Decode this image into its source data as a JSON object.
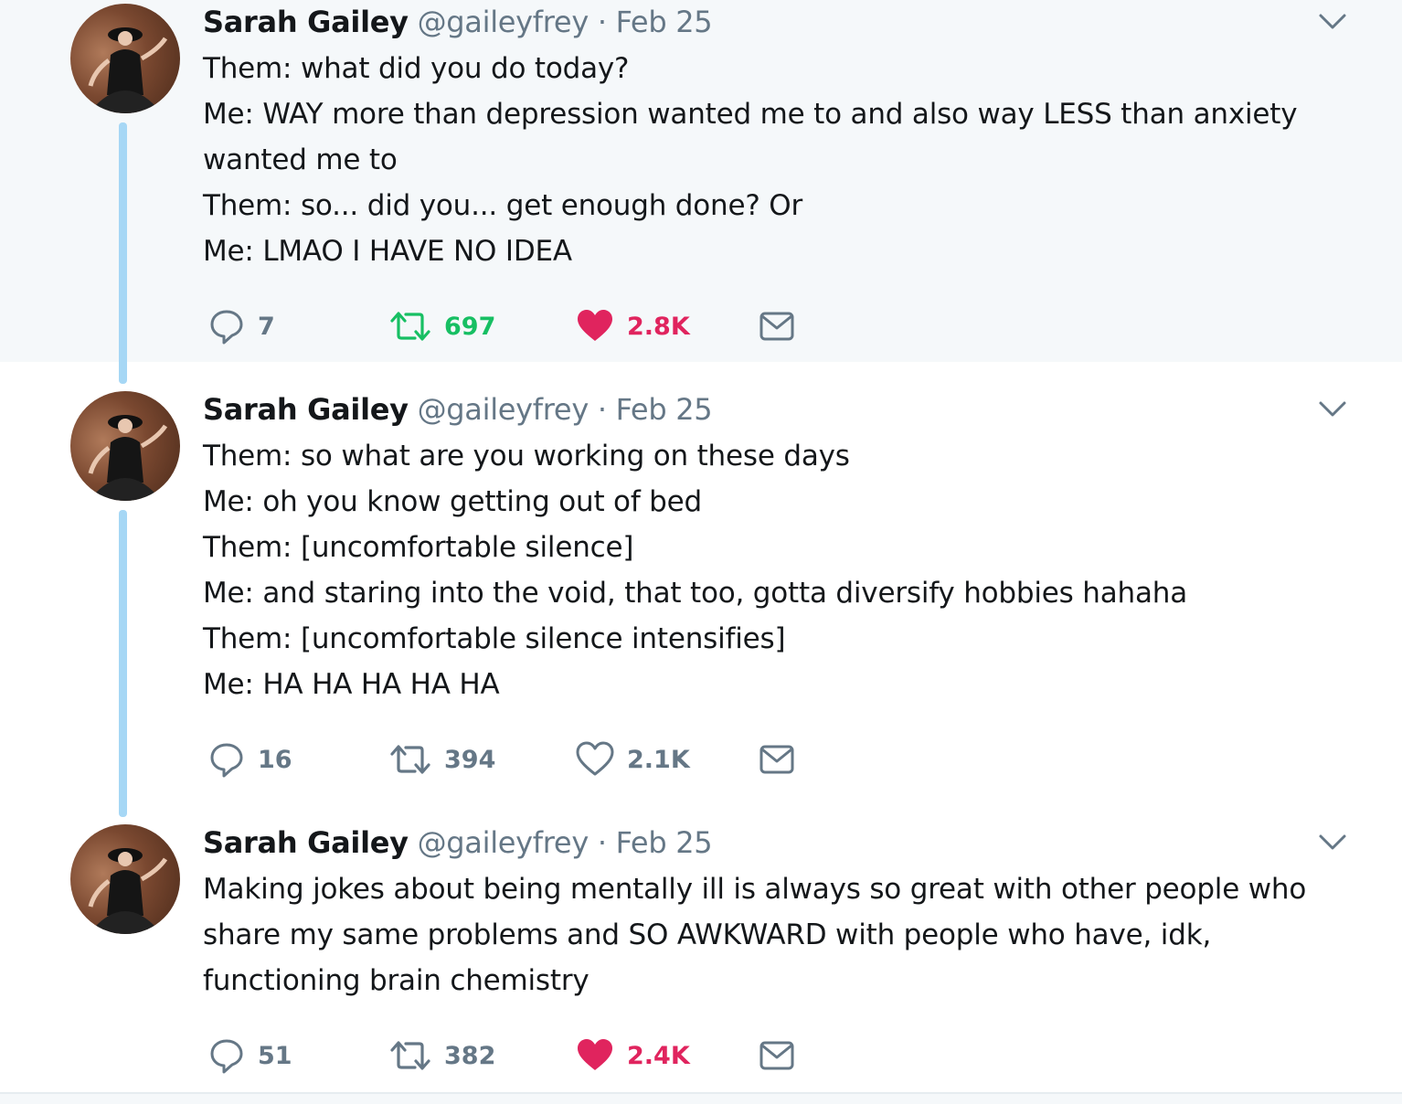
{
  "colors": {
    "thread_line": "#a6d7f5",
    "retweet_active": "#17bf63",
    "like_active": "#e0245e",
    "secondary_text": "#657786",
    "highlight_bg": "#f5f8fa"
  },
  "tweets": [
    {
      "name": "Sarah Gailey",
      "handle": "@gaileyfrey",
      "separator": "·",
      "date": "Feb 25",
      "lines": [
        "Them: what did you do today?",
        "Me: WAY more than depression wanted me to and also way LESS than anxiety",
        "wanted me to",
        "Them: so... did you... get enough done? Or",
        "Me: LMAO I HAVE NO IDEA"
      ],
      "replies": "7",
      "retweets": "697",
      "likes": "2.8K",
      "retweeted": true,
      "liked": true
    },
    {
      "name": "Sarah Gailey",
      "handle": "@gaileyfrey",
      "separator": "·",
      "date": "Feb 25",
      "lines": [
        "Them: so what are you working on these days",
        "Me: oh you know getting out of bed",
        "Them: [uncomfortable silence]",
        "Me: and staring into the void, that too, gotta diversify hobbies hahaha",
        "Them: [uncomfortable silence intensifies]",
        "Me: HA HA HA HA HA"
      ],
      "replies": "16",
      "retweets": "394",
      "likes": "2.1K",
      "retweeted": false,
      "liked": false
    },
    {
      "name": "Sarah Gailey",
      "handle": "@gaileyfrey",
      "separator": "·",
      "date": "Feb 25",
      "lines": [
        "Making jokes about being mentally ill is always so great with other people who",
        "share my same problems and SO AWKWARD with people who have, idk,",
        "functioning brain chemistry"
      ],
      "replies": "51",
      "retweets": "382",
      "likes": "2.4K",
      "retweeted": false,
      "liked": true
    }
  ]
}
